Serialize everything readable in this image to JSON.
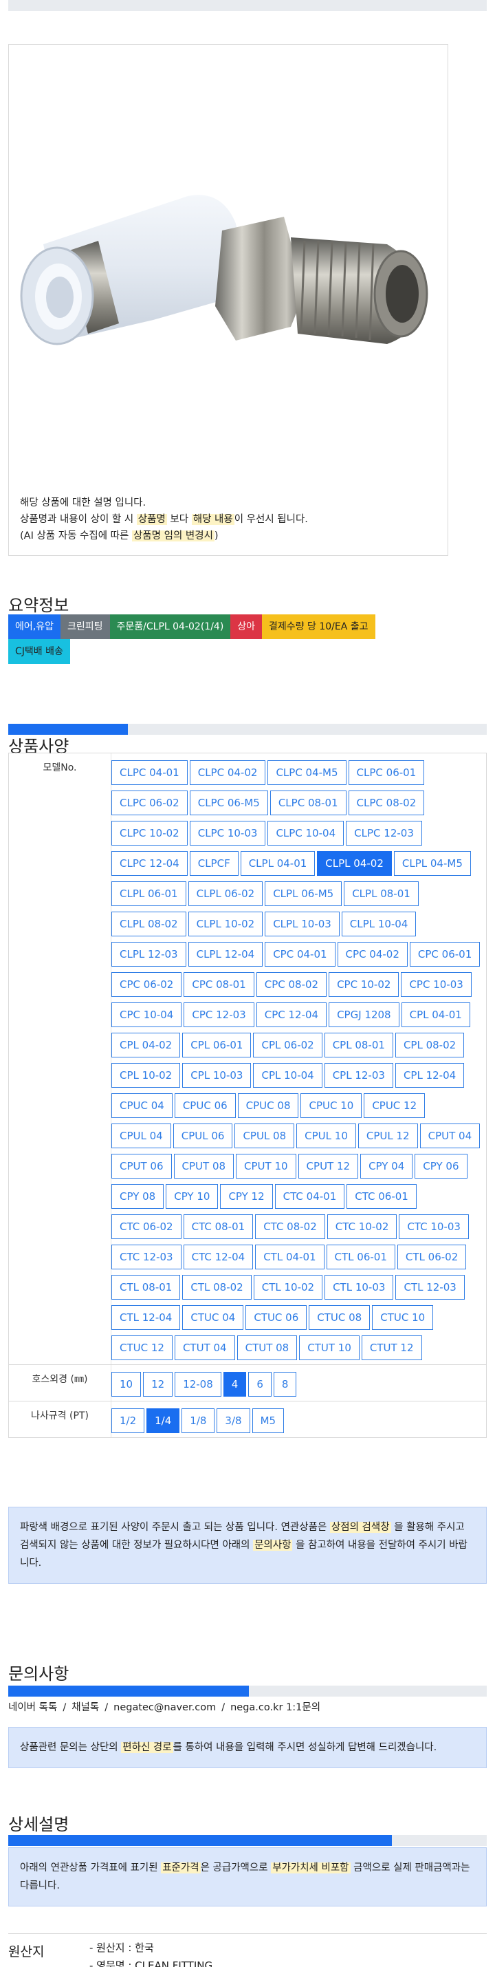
{
  "product_box": {
    "desc_line1": "해당 상품에 대한 설명 입니다.",
    "desc_line2_a": "상품명과 내용이 상이 할 시 ",
    "desc_line2_hl1": "상품명",
    "desc_line2_b": " 보다 ",
    "desc_line2_hl2": "해당 내용",
    "desc_line2_c": "이 우선시 됩니다.",
    "desc_line3_a": "(AI 상품 자동 수집에 따른 ",
    "desc_line3_hl": "상품명 임의 변경시",
    "desc_line3_b": ")"
  },
  "summary": {
    "title": "요약정보",
    "tags": [
      {
        "label": "에어,유압",
        "color": "#1a6ef0"
      },
      {
        "label": "크린피팅",
        "color": "#6c757d"
      },
      {
        "label": "주문품/CLPL 04-02(1/4)",
        "color": "#2a8a52"
      },
      {
        "label": "상아",
        "color": "#dc3545"
      },
      {
        "label": "결제수량 당 10/EA 출고",
        "color": "#f6c01c",
        "dark": true
      },
      {
        "label": "CJ택배 배송",
        "color": "#18c0e0",
        "dark": true
      }
    ]
  },
  "spec": {
    "title": "상품사양",
    "model_label": "모델No.",
    "models": [
      "CLPC 04-01",
      "CLPC 04-02",
      "CLPC 04-M5",
      "CLPC 06-01",
      "CLPC 06-02",
      "CLPC 06-M5",
      "CLPC 08-01",
      "CLPC 08-02",
      "CLPC 10-02",
      "CLPC 10-03",
      "CLPC 10-04",
      "CLPC 12-03",
      "CLPC 12-04",
      "CLPCF",
      "CLPL 04-01",
      "CLPL 04-02",
      "CLPL 04-M5",
      "CLPL 06-01",
      "CLPL 06-02",
      "CLPL 06-M5",
      "CLPL 08-01",
      "CLPL 08-02",
      "CLPL 10-02",
      "CLPL 10-03",
      "CLPL 10-04",
      "CLPL 12-03",
      "CLPL 12-04",
      "CPC 04-01",
      "CPC 04-02",
      "CPC 06-01",
      "CPC 06-02",
      "CPC 08-01",
      "CPC 08-02",
      "CPC 10-02",
      "CPC 10-03",
      "CPC 10-04",
      "CPC 12-03",
      "CPC 12-04",
      "CPGJ 1208",
      "CPL 04-01",
      "CPL 04-02",
      "CPL 06-01",
      "CPL 06-02",
      "CPL 08-01",
      "CPL 08-02",
      "CPL 10-02",
      "CPL 10-03",
      "CPL 10-04",
      "CPL 12-03",
      "CPL 12-04",
      "CPUC 04",
      "CPUC 06",
      "CPUC 08",
      "CPUC 10",
      "CPUC 12",
      "CPUL 04",
      "CPUL 06",
      "CPUL 08",
      "CPUL 10",
      "CPUL 12",
      "CPUT 04",
      "CPUT 06",
      "CPUT 08",
      "CPUT 10",
      "CPUT 12",
      "CPY 04",
      "CPY 06",
      "CPY 08",
      "CPY 10",
      "CPY 12",
      "CTC 04-01",
      "CTC 06-01",
      "CTC 06-02",
      "CTC 08-01",
      "CTC 08-02",
      "CTC 10-02",
      "CTC 10-03",
      "CTC 12-03",
      "CTC 12-04",
      "CTL 04-01",
      "CTL 06-01",
      "CTL 06-02",
      "CTL 08-01",
      "CTL 08-02",
      "CTL 10-02",
      "CTL 10-03",
      "CTL 12-03",
      "CTL 12-04",
      "CTUC 04",
      "CTUC 06",
      "CTUC 08",
      "CTUC 10",
      "CTUC 12",
      "CTUT 04",
      "CTUT 08",
      "CTUT 10",
      "CTUT 12"
    ],
    "selected_model": "CLPL 04-02",
    "hose_label": "호스외경 (㎜)",
    "hose": [
      "10",
      "12",
      "12-08",
      "4",
      "6",
      "8"
    ],
    "selected_hose": "4",
    "thread_label": "나사규격 (PT)",
    "thread": [
      "1/2",
      "1/4",
      "1/8",
      "3/8",
      "M5"
    ],
    "selected_thread": "1/4",
    "notice_a": "파랑색 배경으로 표기된 사양이 주문시 출고 되는 상품 입니다. 연관상품은 ",
    "notice_hl1": "상점의 검색창",
    "notice_b": " 을 활용해 주시고 검색되지 않는 상품에 대한 정보가 필요하시다면 아래의 ",
    "notice_hl2": "문의사항",
    "notice_c": " 을 참고하여 내용을 전달하여 주시기 바랍니다."
  },
  "inquiry": {
    "title": "문의사항",
    "contacts": [
      "네이버 톡톡",
      "채널톡",
      "negatec@naver.com",
      "nega.co.kr 1:1문의"
    ],
    "separator": "/",
    "notice_a": "상품관련 문의는 상단의 ",
    "notice_hl": "편하신 경로",
    "notice_b": "를 통하여 내용을 입력해 주시면 성실하게 답변해 드리겠습니다."
  },
  "detail": {
    "title": "상세설명",
    "notice_a": "아래의 연관상품 가격표에 표기된 ",
    "notice_hl1": "표준가격",
    "notice_b": "은 공급가액으로 ",
    "notice_hl2": "부가가치세 비포함",
    "notice_c": " 금액으로 실제 판매금액과는 다릅니다."
  },
  "origin": {
    "label": "원산지",
    "items": [
      "- 원산지 : 한국",
      "- 영문명 : CLEAN FITTING"
    ]
  }
}
